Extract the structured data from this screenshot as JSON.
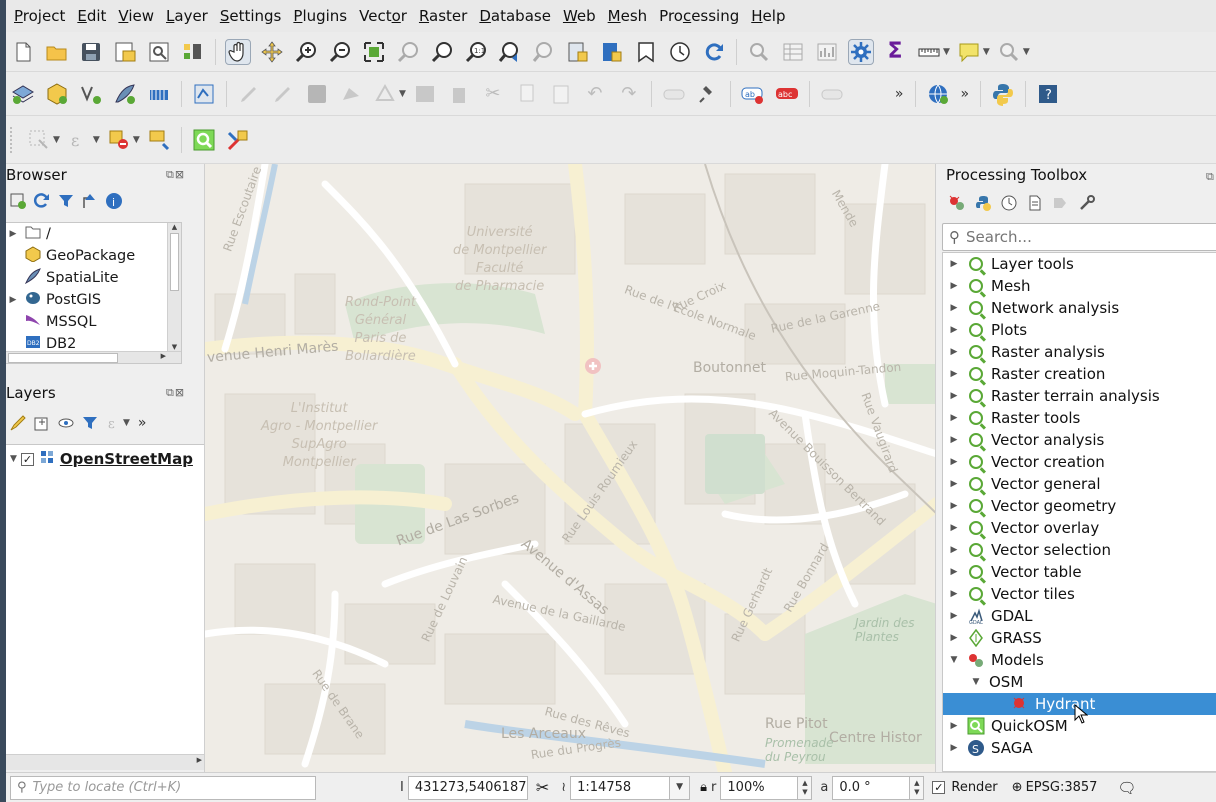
{
  "menu": [
    {
      "pre": "",
      "u": "P",
      "post": "roject"
    },
    {
      "pre": "",
      "u": "E",
      "post": "dit"
    },
    {
      "pre": "",
      "u": "V",
      "post": "iew"
    },
    {
      "pre": "",
      "u": "L",
      "post": "ayer"
    },
    {
      "pre": "",
      "u": "S",
      "post": "ettings"
    },
    {
      "pre": "",
      "u": "P",
      "post": "lugins"
    },
    {
      "pre": "Vect",
      "u": "o",
      "post": "r"
    },
    {
      "pre": "",
      "u": "R",
      "post": "aster"
    },
    {
      "pre": "",
      "u": "D",
      "post": "atabase"
    },
    {
      "pre": "",
      "u": "W",
      "post": "eb"
    },
    {
      "pre": "",
      "u": "M",
      "post": "esh"
    },
    {
      "pre": "Pro",
      "u": "c",
      "post": "essing"
    },
    {
      "pre": "",
      "u": "H",
      "post": "elp"
    }
  ],
  "browser": {
    "title": "Browser",
    "items": [
      {
        "label": "/",
        "icon": "folder-icon"
      },
      {
        "label": "GeoPackage",
        "icon": "geopackage-icon"
      },
      {
        "label": "SpatiaLite",
        "icon": "spatialite-icon"
      },
      {
        "label": "PostGIS",
        "icon": "postgis-icon"
      },
      {
        "label": "MSSQL",
        "icon": "mssql-icon"
      },
      {
        "label": "DB2",
        "icon": "db2-icon"
      }
    ]
  },
  "layers": {
    "title": "Layers",
    "items": [
      {
        "label": "OpenStreetMap",
        "checked": true
      }
    ]
  },
  "map": {
    "labels": {
      "universite": "Université\nde Montpellier\nFaculté\nde Pharmacie",
      "rondpoint": "Rond-Point\nGénéral\nParis de\nBollardière",
      "institut": "L'Institut\nAgro - Montpellier\nSupAgro\nMontpellier",
      "henri": "venue Henri Marès",
      "boutonnet": "Boutonnet",
      "moquin": "Rue Moquin-Tandon",
      "ecole": "Rue de l'École Normale",
      "garenne": "Rue de la Garenne",
      "croix": "Rue Croix",
      "sorbes": "Rue de Las Sorbes",
      "assas": "Avenue d'Assas",
      "gaillarde": "Avenue de la Gaillarde",
      "roumieux": "Rue Louis Roumieux",
      "gerhardt": "Rue Gerhardt",
      "bonnard": "Rue Bonnard",
      "jardin": "Jardin des\nPlantes",
      "pitot": "Rue Pitot",
      "centre": "Centre Histor",
      "arceaux": "Les Arceaux",
      "peyrou": "Promenade\ndu Peyrou",
      "progres": "Rue du Progrès",
      "reves": "Rue des Rêves",
      "brane": "Rue de Brane",
      "louvain": "Rue de Louvain",
      "escoutaire": "Rue Escoutaire",
      "bouisson": "Avenue Bouisson Bertrand",
      "mende": "Mende",
      "lvau": "Rue Vaugirard"
    }
  },
  "toolbox": {
    "title": "Processing Toolbox",
    "search_placeholder": "Search...",
    "items": [
      {
        "label": "Layer tools",
        "kind": "qgis",
        "expander": "right",
        "indent": 0
      },
      {
        "label": "Mesh",
        "kind": "qgis",
        "expander": "right",
        "indent": 0
      },
      {
        "label": "Network analysis",
        "kind": "qgis",
        "expander": "right",
        "indent": 0
      },
      {
        "label": "Plots",
        "kind": "qgis",
        "expander": "right",
        "indent": 0
      },
      {
        "label": "Raster analysis",
        "kind": "qgis",
        "expander": "right",
        "indent": 0
      },
      {
        "label": "Raster creation",
        "kind": "qgis",
        "expander": "right",
        "indent": 0
      },
      {
        "label": "Raster terrain analysis",
        "kind": "qgis",
        "expander": "right",
        "indent": 0
      },
      {
        "label": "Raster tools",
        "kind": "qgis",
        "expander": "right",
        "indent": 0
      },
      {
        "label": "Vector analysis",
        "kind": "qgis",
        "expander": "right",
        "indent": 0
      },
      {
        "label": "Vector creation",
        "kind": "qgis",
        "expander": "right",
        "indent": 0
      },
      {
        "label": "Vector general",
        "kind": "qgis",
        "expander": "right",
        "indent": 0
      },
      {
        "label": "Vector geometry",
        "kind": "qgis",
        "expander": "right",
        "indent": 0
      },
      {
        "label": "Vector overlay",
        "kind": "qgis",
        "expander": "right",
        "indent": 0
      },
      {
        "label": "Vector selection",
        "kind": "qgis",
        "expander": "right",
        "indent": 0
      },
      {
        "label": "Vector table",
        "kind": "qgis",
        "expander": "right",
        "indent": 0
      },
      {
        "label": "Vector tiles",
        "kind": "qgis",
        "expander": "right",
        "indent": 0
      },
      {
        "label": "GDAL",
        "kind": "gdal",
        "expander": "right",
        "indent": 0
      },
      {
        "label": "GRASS",
        "kind": "grass",
        "expander": "right",
        "indent": 0
      },
      {
        "label": "Models",
        "kind": "models",
        "expander": "down",
        "indent": 0
      },
      {
        "label": "OSM",
        "kind": "none",
        "expander": "down",
        "indent": 1
      },
      {
        "label": "Hydrant",
        "kind": "model",
        "expander": "none",
        "indent": 2,
        "selected": true
      },
      {
        "label": "QuickOSM",
        "kind": "quickosm",
        "expander": "right",
        "indent": 0
      },
      {
        "label": "SAGA",
        "kind": "saga",
        "expander": "right",
        "indent": 0
      }
    ]
  },
  "status": {
    "locate_placeholder": "Type to locate (Ctrl+K)",
    "coordinate": "431273,5406187",
    "scale": "1:14758",
    "magnifier": "100%",
    "rotation": "0.0 °",
    "render_label": "Render",
    "crs": "EPSG:3857",
    "coord_prefix": "I",
    "scale_prefix": "≀",
    "mag_prefix": "r",
    "rot_prefix": "a"
  },
  "colors": {
    "accent_selected": "#3a8ed4",
    "qgis_green": "#5aa836"
  }
}
